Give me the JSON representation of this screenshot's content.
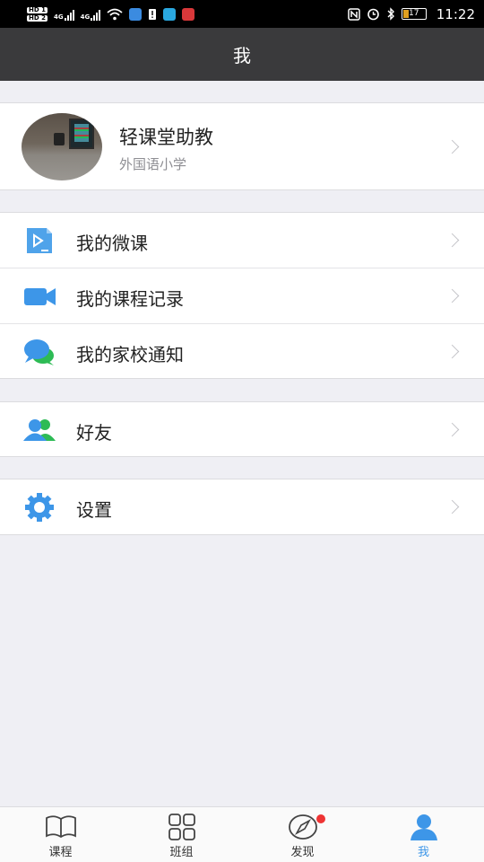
{
  "status_bar": {
    "sim1": "HD 1",
    "sim2": "HD 2",
    "net1": "4G",
    "net2": "4G",
    "battery": "17",
    "time": "11:22"
  },
  "header": {
    "title": "我"
  },
  "profile": {
    "name": "轻课堂助教",
    "school": "外国语小学"
  },
  "menu": {
    "micro_lessons": "我的微课",
    "course_records": "我的课程记录",
    "home_school": "我的家校通知",
    "friends": "好友",
    "settings": "设置"
  },
  "bottom_nav": [
    {
      "label": "课程",
      "icon": "book-icon"
    },
    {
      "label": "班组",
      "icon": "grid-icon"
    },
    {
      "label": "发现",
      "icon": "compass-icon"
    },
    {
      "label": "我",
      "icon": "person-icon"
    }
  ],
  "colors": {
    "accent": "#3d96e8",
    "header": "#3a3a3c",
    "badge": "#ee3333"
  }
}
